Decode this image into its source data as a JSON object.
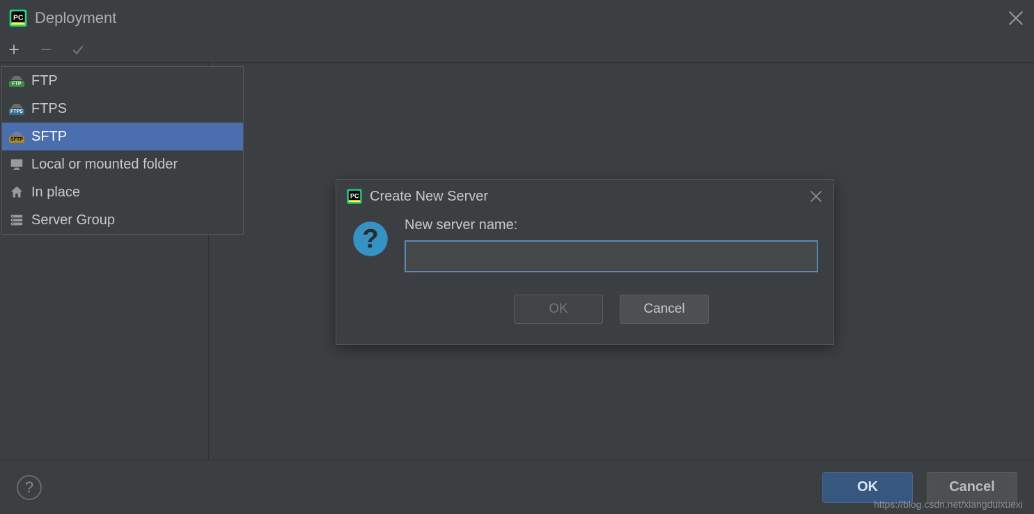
{
  "window": {
    "title": "Deployment"
  },
  "toolbar": {
    "add_tip": "Add",
    "remove_tip": "Remove",
    "apply_tip": "Apply"
  },
  "menu": {
    "items": [
      {
        "label": "FTP",
        "badge": "FTP"
      },
      {
        "label": "FTPS",
        "badge": "FTPS"
      },
      {
        "label": "SFTP",
        "badge": "SFTP"
      },
      {
        "label": "Local or mounted folder"
      },
      {
        "label": "In place"
      },
      {
        "label": "Server Group"
      }
    ],
    "selected_index": 2
  },
  "modal": {
    "title": "Create New Server",
    "field_label": "New server name:",
    "field_value": "",
    "ok": "OK",
    "cancel": "Cancel",
    "ok_enabled": false
  },
  "bottom": {
    "ok": "OK",
    "cancel": "Cancel"
  },
  "watermark": "https://blog.csdn.net/xiangduixuexi"
}
